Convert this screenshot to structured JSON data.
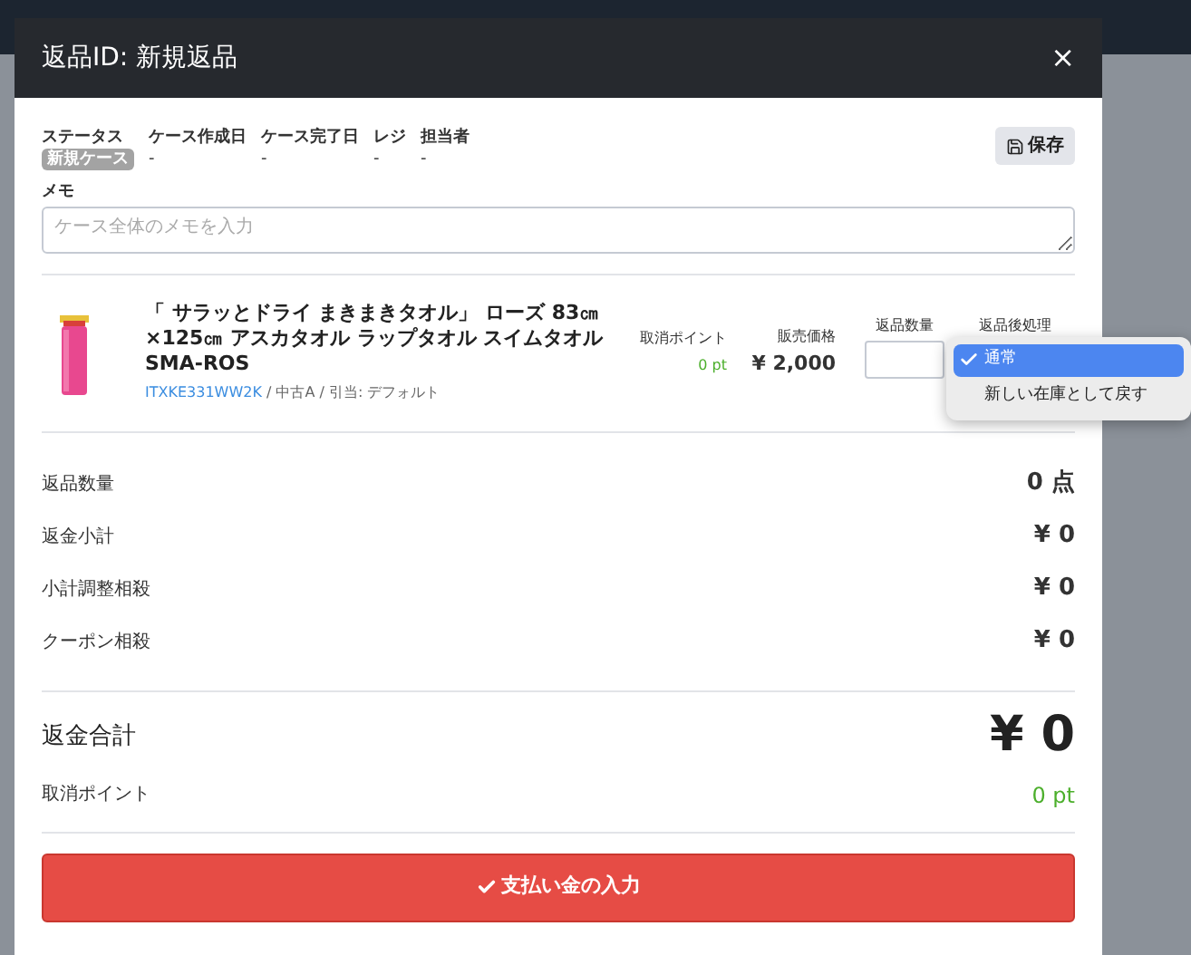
{
  "modal": {
    "title": "返品ID: 新規返品",
    "close": "×"
  },
  "case_info": [
    {
      "label": "ステータス",
      "value": "新規ケース",
      "kind": "badge"
    },
    {
      "label": "ケース作成日",
      "value": "-",
      "kind": "text"
    },
    {
      "label": "ケース完了日",
      "value": "-",
      "kind": "text"
    },
    {
      "label": "レジ",
      "value": "-",
      "kind": "text"
    },
    {
      "label": "担当者",
      "value": "-",
      "kind": "text"
    }
  ],
  "save_button": "保存",
  "memo": {
    "label": "メモ",
    "placeholder": "ケース全体のメモを入力"
  },
  "item": {
    "name": "「 サラッとドライ まきまきタオル」 ローズ 83㎝ ×125㎝ アスカタオル ラップタオル スイムタオル SMA-ROS",
    "sku": "ITXKE331WW2K",
    "details": "/ 中古A / 引当: デフォルト",
    "cancel_points_label": "取消ポイント",
    "cancel_points": "0 pt",
    "price_label": "販売価格",
    "price": "¥ 2,000",
    "quantity_label": "返品数量",
    "disposition_label": "返品後処理",
    "disposition_options": [
      {
        "label": "通常",
        "selected": true
      },
      {
        "label": "新しい在庫として戻す",
        "selected": false
      }
    ]
  },
  "summary": [
    {
      "label": "返品数量",
      "value": "0 点"
    },
    {
      "label": "返金小計",
      "value": "¥ 0"
    },
    {
      "label": "小計調整相殺",
      "value": "¥ 0"
    },
    {
      "label": "クーポン相殺",
      "value": "¥ 0"
    }
  ],
  "total": {
    "label": "返金合計",
    "value": "¥ 0"
  },
  "points": {
    "label": "取消ポイント",
    "value": "0 pt"
  },
  "submit_button": "支払い金の入力"
}
